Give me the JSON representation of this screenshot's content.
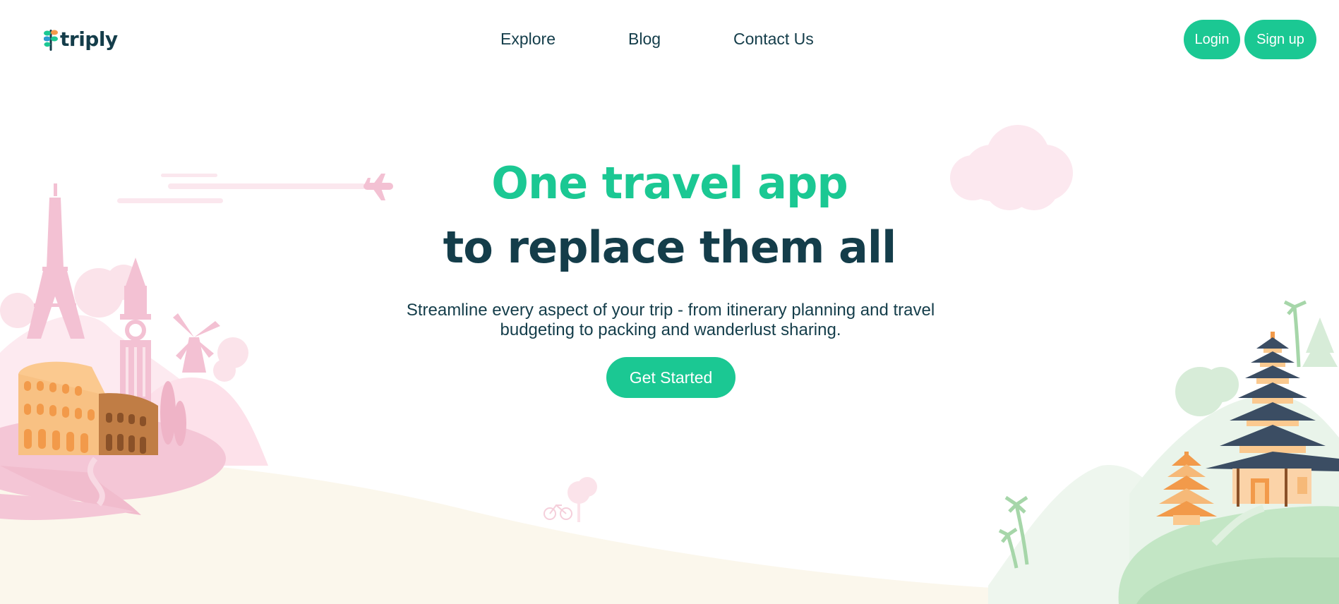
{
  "brand": {
    "name": "triply",
    "accent": "#1bc893",
    "dark": "#143d4a"
  },
  "nav": {
    "links": [
      {
        "label": "Explore"
      },
      {
        "label": "Blog"
      },
      {
        "label": "Contact Us"
      }
    ],
    "login_label": "Login",
    "signup_label": "Sign up"
  },
  "hero": {
    "title_line1": "One travel app",
    "title_line2": "to replace them all",
    "subtitle": "Streamline every aspect of your trip - from itinerary planning and travel budgeting to packing and wanderlust sharing.",
    "cta_label": "Get Started"
  },
  "illustration": {
    "icons": [
      "airplane-icon",
      "eiffel-tower-icon",
      "big-ben-icon",
      "windmill-icon",
      "colosseum-icon",
      "pagoda-icon",
      "palm-tree-icon",
      "bicycle-icon",
      "cloud-icon"
    ],
    "colors": {
      "pink": "#f4c6d6",
      "sand": "#fbf7ec",
      "green": "#c3e6c5",
      "orange": "#f29a4a",
      "slate": "#3b4d63"
    }
  }
}
